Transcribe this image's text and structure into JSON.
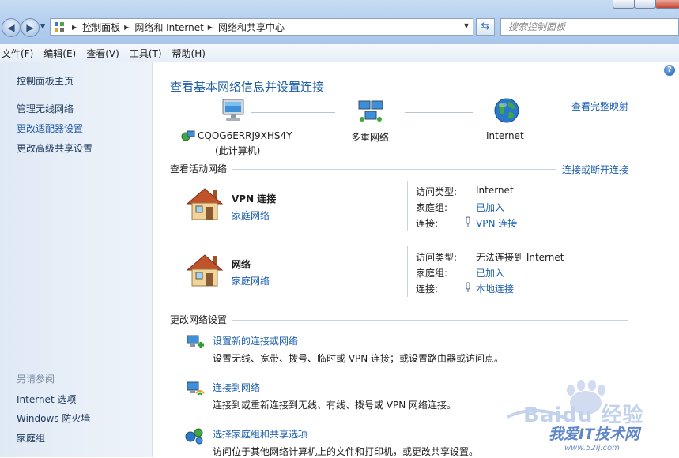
{
  "address_bar": {
    "breadcrumbs": [
      "控制面板",
      "网络和 Internet",
      "网络和共享中心"
    ],
    "search_placeholder": "搜索控制面板"
  },
  "menu": [
    "文件(F)",
    "编辑(E)",
    "查看(V)",
    "工具(T)",
    "帮助(H)"
  ],
  "sidebar": {
    "items": [
      {
        "label": "控制面板主页"
      },
      {
        "label": "管理无线网络"
      },
      {
        "label": "更改适配器设置"
      },
      {
        "label": "更改高级共享设置"
      }
    ],
    "see_also_label": "另请参阅",
    "see_also": [
      {
        "label": "Internet 选项"
      },
      {
        "label": "Windows 防火墙"
      },
      {
        "label": "家庭组"
      }
    ]
  },
  "main": {
    "title": "查看基本网络信息并设置连接",
    "view_full_map": "查看完整映射",
    "map": {
      "computer_name": "CQOG6ERRJ9XHS4Y",
      "computer_sub": "(此计算机)",
      "network": "多重网络",
      "internet": "Internet"
    },
    "active_header": "查看活动网络",
    "connect_disconnect": "连接或断开连接",
    "networks": [
      {
        "name": "VPN 连接",
        "type": "家庭网络",
        "props": [
          {
            "label": "访问类型:",
            "value": "Internet",
            "is_link": false
          },
          {
            "label": "家庭组:",
            "value": "已加入",
            "is_link": true
          },
          {
            "label": "连接:",
            "value": "VPN 连接",
            "is_link": true
          }
        ]
      },
      {
        "name": "网络",
        "type": "家庭网络",
        "props": [
          {
            "label": "访问类型:",
            "value": "无法连接到 Internet",
            "is_link": false
          },
          {
            "label": "家庭组:",
            "value": "已加入",
            "is_link": true
          },
          {
            "label": "连接:",
            "value": "本地连接",
            "is_link": true
          }
        ]
      }
    ],
    "change_header": "更改网络设置",
    "tasks": [
      {
        "title": "设置新的连接或网络",
        "desc": "设置无线、宽带、拨号、临时或 VPN 连接；或设置路由器或访问点。"
      },
      {
        "title": "连接到网络",
        "desc": "连接到或重新连接到无线、有线、拨号或 VPN 网络连接。"
      },
      {
        "title": "选择家庭组和共享选项",
        "desc": "访问位于其他网络计算机上的文件和打印机，或更改共享设置。"
      }
    ]
  },
  "watermark": {
    "brand": "Baidu 经验",
    "site": "我爱IT技术网",
    "url": "www.52ij.com"
  }
}
